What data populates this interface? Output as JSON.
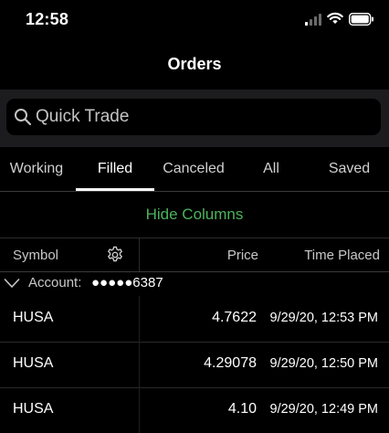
{
  "status_bar": {
    "time": "12:58",
    "icons": [
      "signal-icon",
      "wifi-icon",
      "battery-icon"
    ]
  },
  "header": {
    "title": "Orders"
  },
  "search": {
    "placeholder": "Quick Trade",
    "value": ""
  },
  "tabs": [
    {
      "label": "Working",
      "active": false
    },
    {
      "label": "Filled",
      "active": true
    },
    {
      "label": "Canceled",
      "active": false
    },
    {
      "label": "All",
      "active": false
    },
    {
      "label": "Saved",
      "active": false
    }
  ],
  "hide_columns": {
    "label": "Hide Columns"
  },
  "columns": {
    "symbol": "Symbol",
    "price": "Price",
    "time_placed": "Time Placed"
  },
  "account": {
    "label": "Account:",
    "number": "●●●●●6387"
  },
  "orders": [
    {
      "symbol": "HUSA",
      "price": "4.7622",
      "time": "9/29/20, 12:53 PM"
    },
    {
      "symbol": "HUSA",
      "price": "4.29078",
      "time": "9/29/20, 12:50 PM"
    },
    {
      "symbol": "HUSA",
      "price": "4.10",
      "time": "9/29/20, 12:49 PM"
    }
  ],
  "colors": {
    "background": "#000000",
    "search_band": "#1c1c1e",
    "accent_green": "#4cb35c",
    "text_primary": "#ffffff",
    "text_secondary": "#c8c8c8"
  }
}
